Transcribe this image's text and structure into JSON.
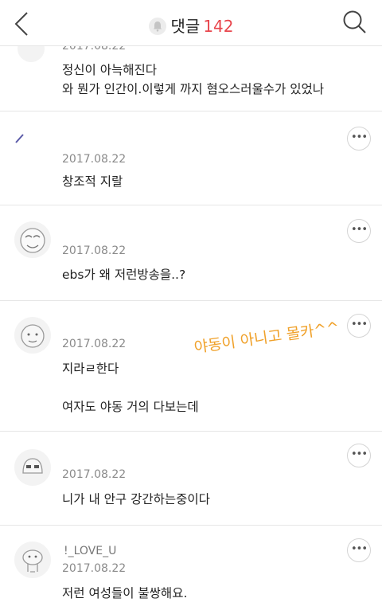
{
  "header": {
    "title": "댓글",
    "count": "142"
  },
  "comments": [
    {
      "date": "2017.08.22",
      "text": "정신이 아늑해진다\n와 뭔가 인간이.이렇게 까지 혐오스러울수가 있었나"
    },
    {
      "date": "2017.08.22",
      "text": "창조적 지랄"
    },
    {
      "date": "2017.08.22",
      "text": "ebs가 왜 저런방송을..?"
    },
    {
      "date": "2017.08.22",
      "text": "지라ㄹ한다\n\n여자도 야동 거의 다보는데"
    },
    {
      "date": "2017.08.22",
      "text": "니가 내 안구 강간하는중이다"
    },
    {
      "nickname": "!_LOVE_U",
      "date": "2017.08.22",
      "text": "저런 여성들이 불쌍해요."
    }
  ],
  "more_label": "•••",
  "overlay_text": "야동이 아니고 몰카^^",
  "colors": {
    "accent": "#e8464d",
    "overlay": "#f0a12a"
  },
  "icons": {
    "back": "chevron-left-icon",
    "notify": "bell-icon",
    "search": "search-icon",
    "more": "more-icon"
  }
}
